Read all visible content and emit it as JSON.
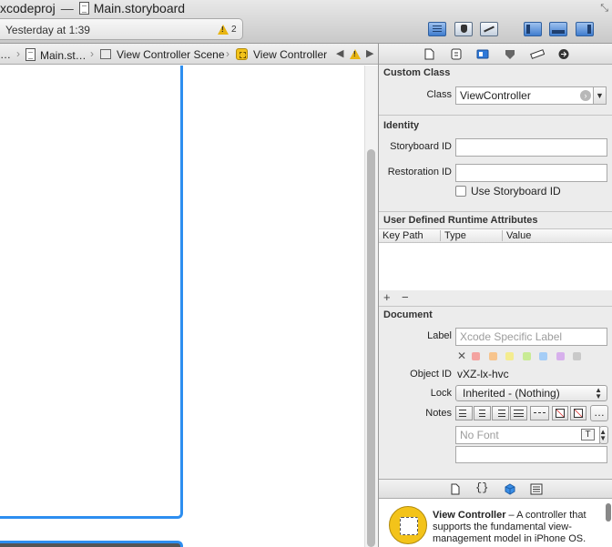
{
  "window": {
    "project_fragment": "xcodeproj",
    "separator": "—",
    "document_name": "Main.storyboard"
  },
  "status": {
    "text": "Yesterday at 1:39",
    "warning_count": "2"
  },
  "jump_bar": {
    "crumbs": [
      "…",
      "Main.st…",
      "View Controller Scene",
      "View Controller"
    ]
  },
  "inspector": {
    "custom_class": {
      "heading": "Custom Class",
      "class_label": "Class",
      "class_value": "ViewController"
    },
    "identity": {
      "heading": "Identity",
      "storyboard_id_label": "Storyboard ID",
      "storyboard_id_value": "",
      "restoration_id_label": "Restoration ID",
      "restoration_id_value": "",
      "use_storyboard_id_label": "Use Storyboard ID",
      "use_storyboard_id_checked": false
    },
    "runtime_attributes": {
      "heading": "User Defined Runtime Attributes",
      "columns": [
        "Key Path",
        "Type",
        "Value"
      ],
      "rows": [],
      "add_symbol": "+",
      "remove_symbol": "−"
    },
    "document": {
      "heading": "Document",
      "label_label": "Label",
      "label_value": "",
      "label_placeholder": "Xcode Specific Label",
      "clear_label_symbol": "✕",
      "label_colors": [
        "#f4a3a0",
        "#f7c48d",
        "#f4ec8f",
        "#c8eb94",
        "#a5cdf6",
        "#d7b0ec",
        "#c9c9c9"
      ],
      "object_id_label": "Object ID",
      "object_id_value": "vXZ-lx-hvc",
      "lock_label": "Lock",
      "lock_value": "Inherited - (Nothing)",
      "notes_label": "Notes",
      "font_value": "No Font",
      "font_button_glyph": "T",
      "more_glyph": "…",
      "notes_text": ""
    },
    "library_tabs": [
      "file-template-icon",
      "code-snippet-icon",
      "object-library-icon",
      "media-library-icon"
    ],
    "library_item": {
      "title": "View Controller",
      "description": " – A controller that supports the fundamental view-management model in iPhone OS."
    }
  },
  "colors": {
    "accent": "#2d8ef0",
    "warning": "#e8b511",
    "object_icon": "#f3c31a"
  }
}
